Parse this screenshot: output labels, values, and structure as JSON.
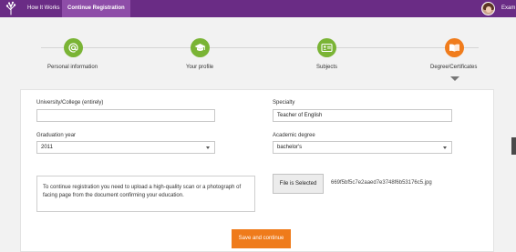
{
  "nav": {
    "how_it_works": "How It Works",
    "continue_registration": "Continue Registration",
    "user_name": "Exam"
  },
  "steps": [
    {
      "label": "Personal information",
      "status": "completed",
      "icon": "at-sign-icon"
    },
    {
      "label": "Your profile",
      "status": "completed",
      "icon": "graduation-cap-icon"
    },
    {
      "label": "Subjects",
      "status": "completed",
      "icon": "id-card-icon"
    },
    {
      "label": "Degree/Certificates",
      "status": "current",
      "icon": "open-book-icon"
    }
  ],
  "form": {
    "university_label": "University/College (entirely)",
    "university_value": "",
    "specialty_label": "Specialty",
    "specialty_value": "Teacher of English",
    "graduation_year_label": "Graduation year",
    "graduation_year_value": "2011",
    "academic_degree_label": "Academic degree",
    "academic_degree_value": "bachelor's",
    "notice_text": "To continue registration you need to upload a high-quality scan or a photograph of facing page from the document confirming your education.",
    "file_button": "File is Selected",
    "file_name": "669f5bf5c7e2aaed7e3748f6b53176c5.jpg",
    "save_button": "Save and continue"
  },
  "colors": {
    "nav_bg": "#6a2c85",
    "step_done": "#7ab435",
    "step_current": "#f07c1c",
    "primary_button": "#ef7b1b"
  }
}
